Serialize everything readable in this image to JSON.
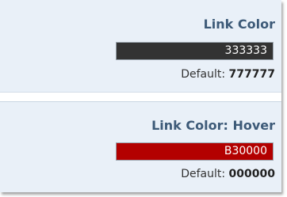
{
  "link_color": {
    "title": "Link Color",
    "value": "333333",
    "swatch_color": "#333333",
    "default_label": "Default:",
    "default_value": "777777"
  },
  "link_color_hover": {
    "title": "Link Color: Hover",
    "value": "B30000",
    "swatch_color": "#B30000",
    "default_label": "Default:",
    "default_value": "000000"
  }
}
